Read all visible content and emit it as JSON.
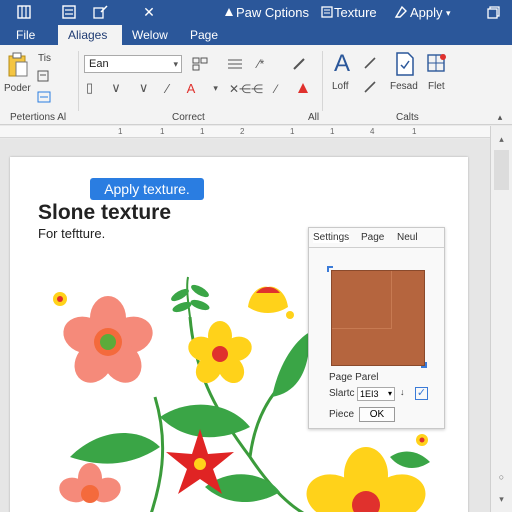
{
  "titlebar": {
    "view_icon": "columns-icon",
    "save_icon": "save-icon",
    "edit_icon": "edit-icon",
    "close_glyph": "✕",
    "options_label": "Paw Cptions",
    "texture_label": "Texture",
    "apply_label": "Apply",
    "window_icon": "restore-icon"
  },
  "tabs": [
    "File",
    "Aliages",
    "Welow",
    "Page"
  ],
  "ribbon": {
    "paste_label": "Poder",
    "tis_label": "Tis",
    "font_name": "Ean",
    "group_left": "Petertions Al",
    "group_correct": "Correct",
    "group_all": "All",
    "group_cells": "Calts",
    "loff_label": "Loff",
    "fesad_label": "Fesad",
    "flet_label": "Flet",
    "colors": {
      "brand": "#2b579a",
      "accent": "#2a7de1",
      "red": "#e0312d"
    }
  },
  "ruler": [
    "1",
    "1",
    "1",
    "2",
    "1",
    "1",
    "4",
    "1"
  ],
  "document": {
    "tooltip": "Apply texture.",
    "title": "Slone texture",
    "subtitle": "For teftture."
  },
  "panel": {
    "tabs": [
      "Settings",
      "Page",
      "Neul"
    ],
    "panel_label": "Page Parel",
    "size_label": "Slartc",
    "size_value": "1EI3",
    "place_label": "Piece",
    "ok_label": "OK",
    "swatch_color": "#b5653e"
  }
}
